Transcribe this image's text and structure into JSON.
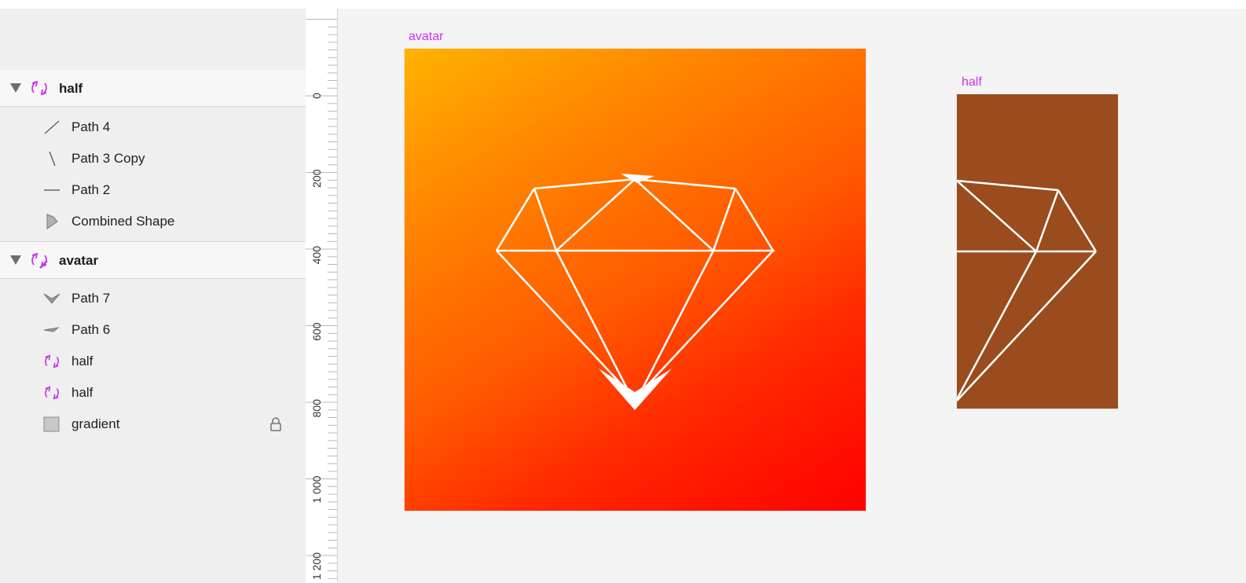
{
  "layers": {
    "groups": [
      {
        "name": "half",
        "children": [
          {
            "name": "Path 4",
            "icon": "diagonal-line-icon"
          },
          {
            "name": "Path 3 Copy",
            "icon": "backslash-line-icon"
          },
          {
            "name": "Path 2",
            "icon": "horizontal-line-icon"
          },
          {
            "name": "Combined Shape",
            "icon": "shape-icon"
          }
        ]
      },
      {
        "name": "avatar",
        "children": [
          {
            "name": "Path 7",
            "icon": "chevron-shape-icon"
          },
          {
            "name": "Path 6",
            "icon": "small-shape-icon"
          },
          {
            "name": "half",
            "icon": "symbol-icon"
          },
          {
            "name": "half",
            "icon": "symbol-icon"
          },
          {
            "name": "gradient",
            "icon": "rectangle-icon",
            "locked": true
          }
        ]
      }
    ]
  },
  "ruler": {
    "labels": [
      "0",
      "200",
      "400",
      "600",
      "800",
      "1 000",
      "1 200"
    ]
  },
  "canvas": {
    "artboards": [
      {
        "label": "avatar",
        "gradient_start": "#ffb300",
        "gradient_end": "#ff0000"
      },
      {
        "label": "half",
        "fill": "#9a4c1e"
      }
    ]
  },
  "colors": {
    "symbol_accent": "#cc33ee",
    "panel_bg": "#efefef"
  }
}
